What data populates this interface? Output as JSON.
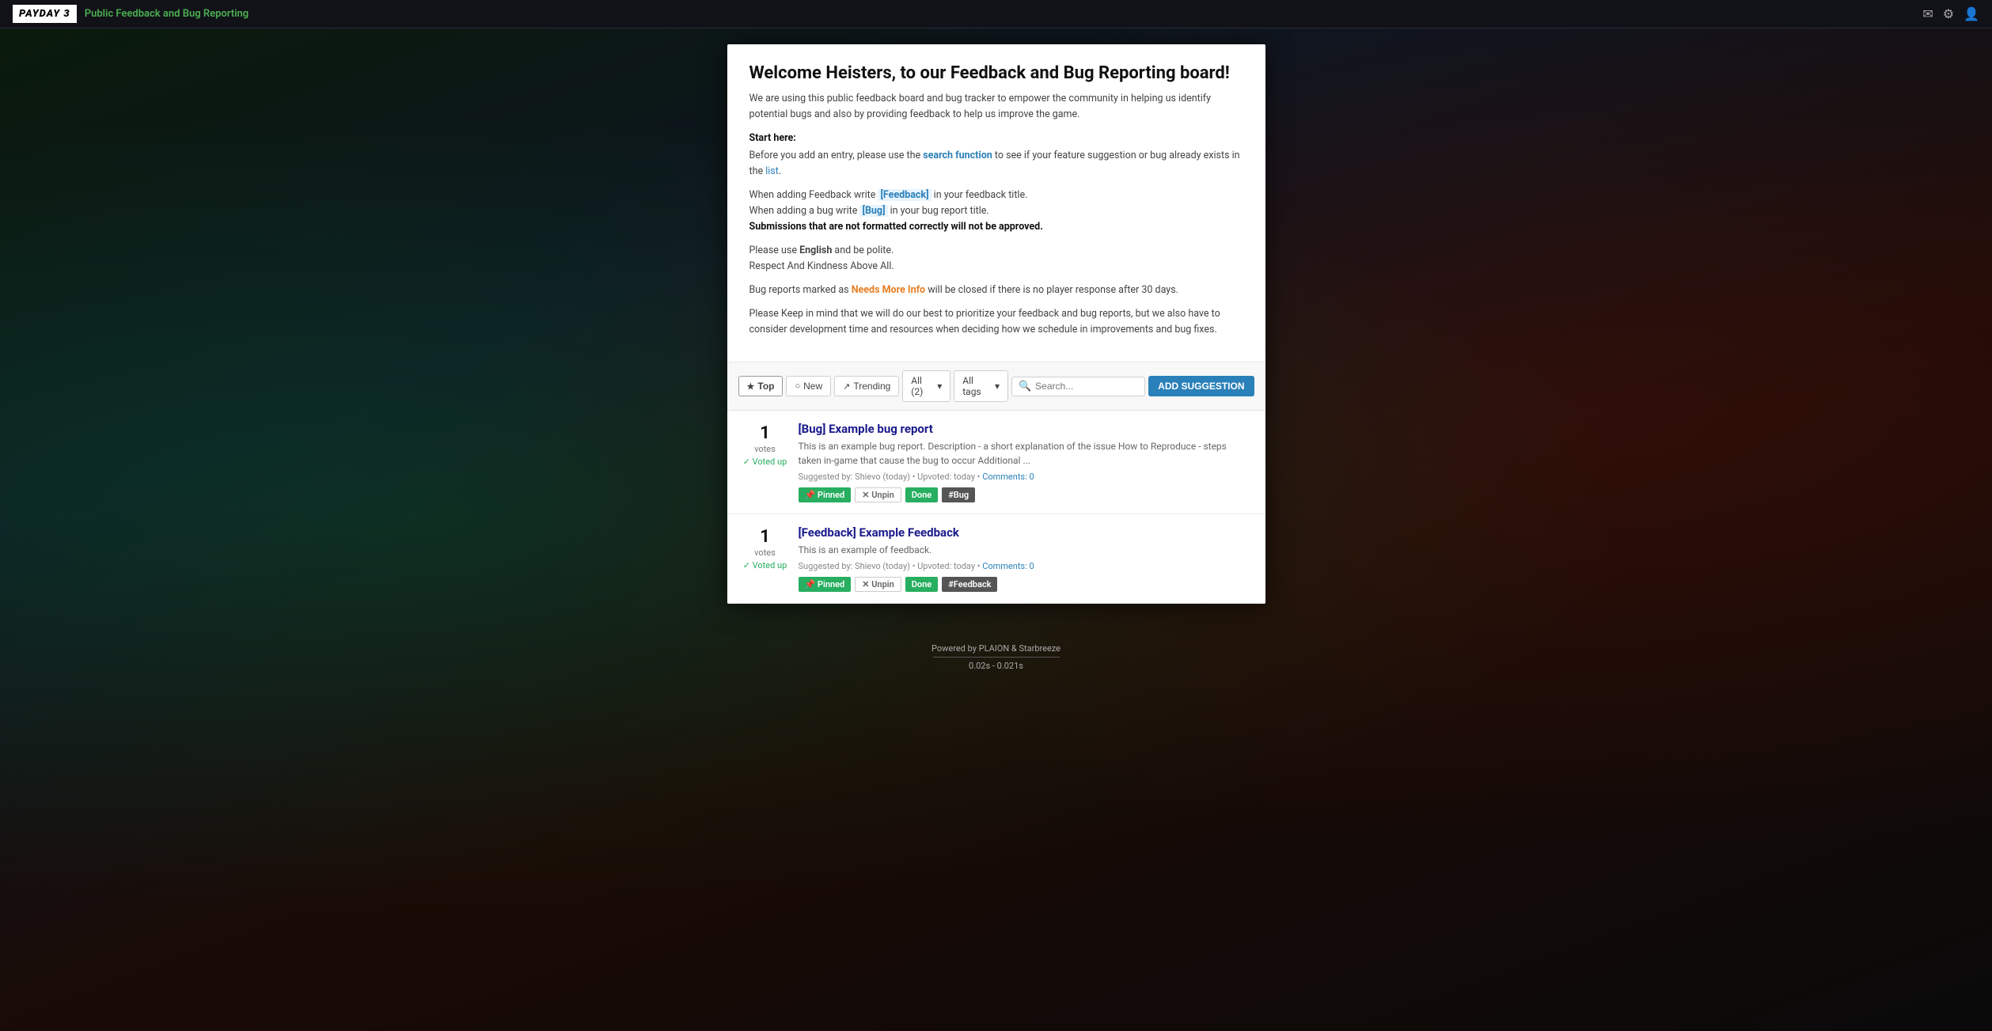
{
  "navbar": {
    "logo_text": "PAYDAY 3",
    "site_title": "Public Feedback and Bug Reporting",
    "icons": [
      "envelope-icon",
      "gear-icon",
      "user-icon"
    ]
  },
  "welcome": {
    "title": "Welcome Heisters, to our Feedback and Bug Reporting board!",
    "intro": "We are using this public feedback board and bug tracker to empower the community in helping us identify potential bugs and also by providing feedback to help us improve the game.",
    "start_here_label": "Start here:",
    "start_here_body": "Before you add an entry, please use the search function to see if your feature suggestion or bug already exists in the list.",
    "feedback_tip": "When adding Feedback write [Feedback] in your feedback title.",
    "bug_tip": "When adding a bug write [Bug] in your bug report title.",
    "format_warning": "Submissions that are not formatted correctly will not be approved.",
    "language_note": "Please use English and be polite.",
    "kindness_note": "Respect And Kindness Above All.",
    "needs_more_info_note": "Bug reports marked as Needs More Info will be closed if there is no player response after 30 days.",
    "priority_note": "Please Keep in mind that we will do our best to prioritize your feedback and bug reports, but we also have to consider development time and resources when deciding how we schedule in improvements and bug fixes."
  },
  "filter_bar": {
    "top_label": "Top",
    "new_label": "New",
    "trending_label": "Trending",
    "all_label": "All (2)",
    "all_tags_label": "All tags",
    "search_placeholder": "Search...",
    "add_btn_label": "ADD SUGGESTION"
  },
  "items": [
    {
      "vote_count": "1",
      "votes_label": "votes",
      "voted_up": "✓ Voted up",
      "title": "[Bug] Example bug report",
      "description": "This is an example bug report. Description - a short explanation of the issue How to Reproduce - steps taken in-game that cause the bug to occur Additional ...",
      "meta": "Suggested by: Shievo (today) • Upvoted: today •",
      "comments_label": "Comments: 0",
      "tags": [
        {
          "type": "pinned",
          "label": "📌 Pinned"
        },
        {
          "type": "unpin",
          "label": "✕ Unpin"
        },
        {
          "type": "done",
          "label": "Done"
        },
        {
          "type": "bug",
          "label": "#Bug"
        }
      ]
    },
    {
      "vote_count": "1",
      "votes_label": "votes",
      "voted_up": "✓ Voted up",
      "title": "[Feedback] Example Feedback",
      "description": "This is an example of feedback.",
      "meta": "Suggested by: Shievo (today) • Upvoted: today •",
      "comments_label": "Comments: 0",
      "tags": [
        {
          "type": "pinned",
          "label": "📌 Pinned"
        },
        {
          "type": "unpin",
          "label": "✕ Unpin"
        },
        {
          "type": "done",
          "label": "Done"
        },
        {
          "type": "feedback",
          "label": "#Feedback"
        }
      ]
    }
  ],
  "footer": {
    "powered_by": "Powered by PLAION & Starbreeze",
    "timing": "0.02s - 0.021s"
  }
}
